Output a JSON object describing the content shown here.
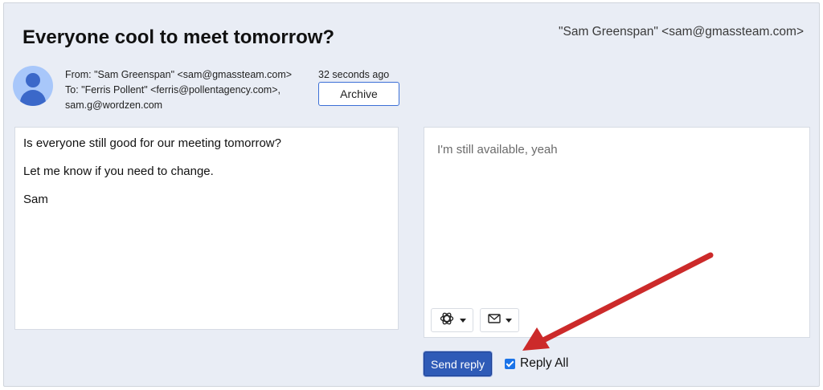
{
  "email": {
    "subject": "Everyone cool to meet tomorrow?",
    "header_sender": "\"Sam Greenspan\" <sam@gmassteam.com>",
    "from_line": "From: \"Sam Greenspan\" <sam@gmassteam.com>",
    "to_line": "To: \"Ferris Pollent\" <ferris@pollentagency.com>,",
    "to_line_2": "sam.g@wordzen.com",
    "time_ago": "32 seconds ago",
    "archive_label": "Archive",
    "body": [
      "Is everyone still good for our meeting tomorrow?",
      "Let me know if you need to change.",
      "Sam"
    ]
  },
  "reply": {
    "text": "I'm still available, yeah",
    "send_label": "Send reply",
    "reply_all_label": "Reply All",
    "reply_all_checked": true,
    "tools": [
      "openai-icon",
      "envelope-icon"
    ]
  },
  "colors": {
    "accent": "#2f5bb7",
    "annotation_arrow": "#cc2a2a",
    "background": "#e9edf5"
  }
}
